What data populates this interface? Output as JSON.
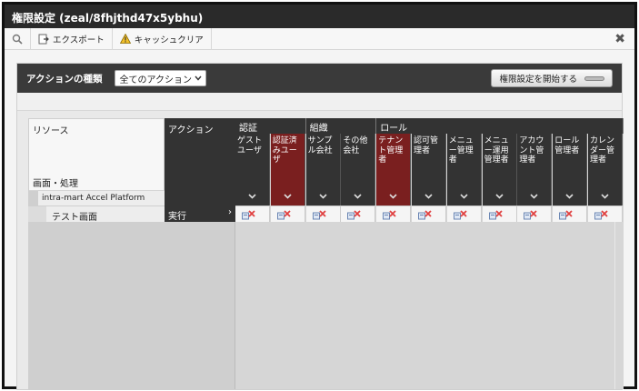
{
  "window": {
    "title": "権限設定 (zeal/8fhjthd47x5ybhu)"
  },
  "toolbar": {
    "export_label": "エクスポート",
    "cache_clear_label": "キャッシュクリア",
    "close_symbol": "✖"
  },
  "filter": {
    "label": "アクションの種類",
    "select_value": "全てのアクション",
    "start_button_label": "権限設定を開始する"
  },
  "grid": {
    "resource_header": "リソース",
    "screen_process_header": "画面・処理",
    "platform_node": "intra-mart Accel Platform",
    "action_header": "アクション",
    "groups": [
      "認証",
      "組織",
      "ロール"
    ],
    "columns": [
      {
        "label": "ゲストユーザ",
        "highlight": false
      },
      {
        "label": "認証済みユーザ",
        "highlight": true
      },
      {
        "label": "サンプル会社",
        "highlight": false
      },
      {
        "label": "その他会社",
        "highlight": false
      },
      {
        "label": "テナント管理者",
        "highlight": true
      },
      {
        "label": "認可管理者",
        "highlight": false
      },
      {
        "label": "メニュー管理者",
        "highlight": false
      },
      {
        "label": "メニュー運用管理者",
        "highlight": false
      },
      {
        "label": "アカウント管理者",
        "highlight": false
      },
      {
        "label": "ロール管理者",
        "highlight": false
      },
      {
        "label": "カレンダー管理者",
        "highlight": false
      }
    ],
    "rows": [
      {
        "resource": "テスト画面",
        "action": "実行"
      }
    ]
  },
  "colors": {
    "dark": "#333333",
    "highlight": "#7a1f1f",
    "deny": "#e04040"
  },
  "icons": [
    "search-icon",
    "export-icon",
    "warning-icon",
    "close-icon",
    "chevron-down-icon",
    "permission-denied-icon"
  ]
}
